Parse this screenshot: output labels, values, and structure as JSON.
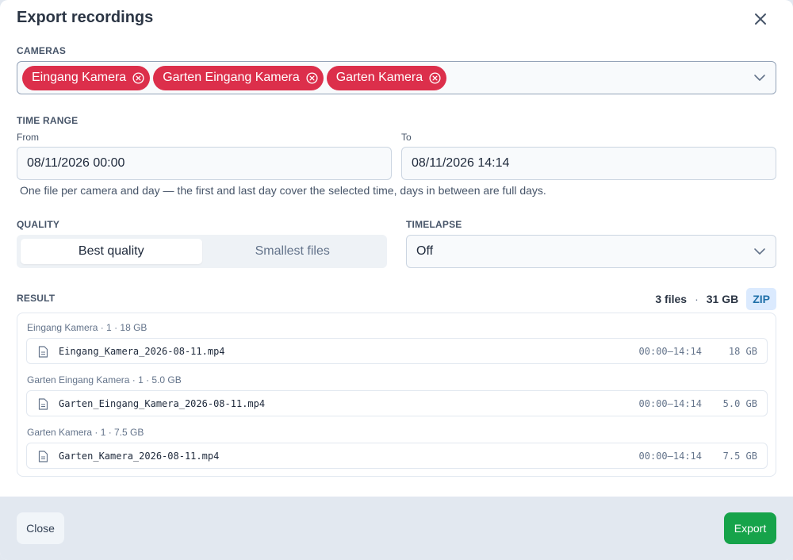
{
  "dialog": {
    "title": "Export recordings"
  },
  "cameras": {
    "label": "CAMERAS",
    "selected": [
      {
        "name": "Eingang Kamera"
      },
      {
        "name": "Garten Eingang Kamera"
      },
      {
        "name": "Garten Kamera"
      }
    ]
  },
  "time_range": {
    "label": "TIME RANGE",
    "from_label": "From",
    "from_value": "08/11/2026 00:00",
    "to_label": "To",
    "to_value": "08/11/2026 14:14",
    "hint": "One file per camera and day — the first and last day cover the selected time, days in between are full days."
  },
  "quality": {
    "label": "QUALITY",
    "options": [
      "Best quality",
      "Smallest files"
    ],
    "selected": "Best quality"
  },
  "timelapse": {
    "label": "TIMELAPSE",
    "value": "Off"
  },
  "result": {
    "label": "RESULT",
    "files_count": "3 files",
    "separator": "·",
    "total_size": "31 GB",
    "zip_label": "ZIP",
    "groups": [
      {
        "label": "Eingang Kamera · 1 · 18 GB",
        "file": {
          "name": "Eingang_Kamera_2026-08-11.mp4",
          "time": "00:00–14:14",
          "size": "18 GB"
        }
      },
      {
        "label": "Garten Eingang Kamera · 1 · 5.0 GB",
        "file": {
          "name": "Garten_Eingang_Kamera_2026-08-11.mp4",
          "time": "00:00–14:14",
          "size": "5.0 GB"
        }
      },
      {
        "label": "Garten Kamera · 1 · 7.5 GB",
        "file": {
          "name": "Garten_Kamera_2026-08-11.mp4",
          "time": "00:00–14:14",
          "size": "7.5 GB"
        }
      }
    ]
  },
  "footer": {
    "close_label": "Close",
    "export_label": "Export"
  },
  "colors": {
    "chip": "#dc2f4b",
    "export_button": "#16a34a",
    "zip_badge_bg": "#dbeafe"
  }
}
